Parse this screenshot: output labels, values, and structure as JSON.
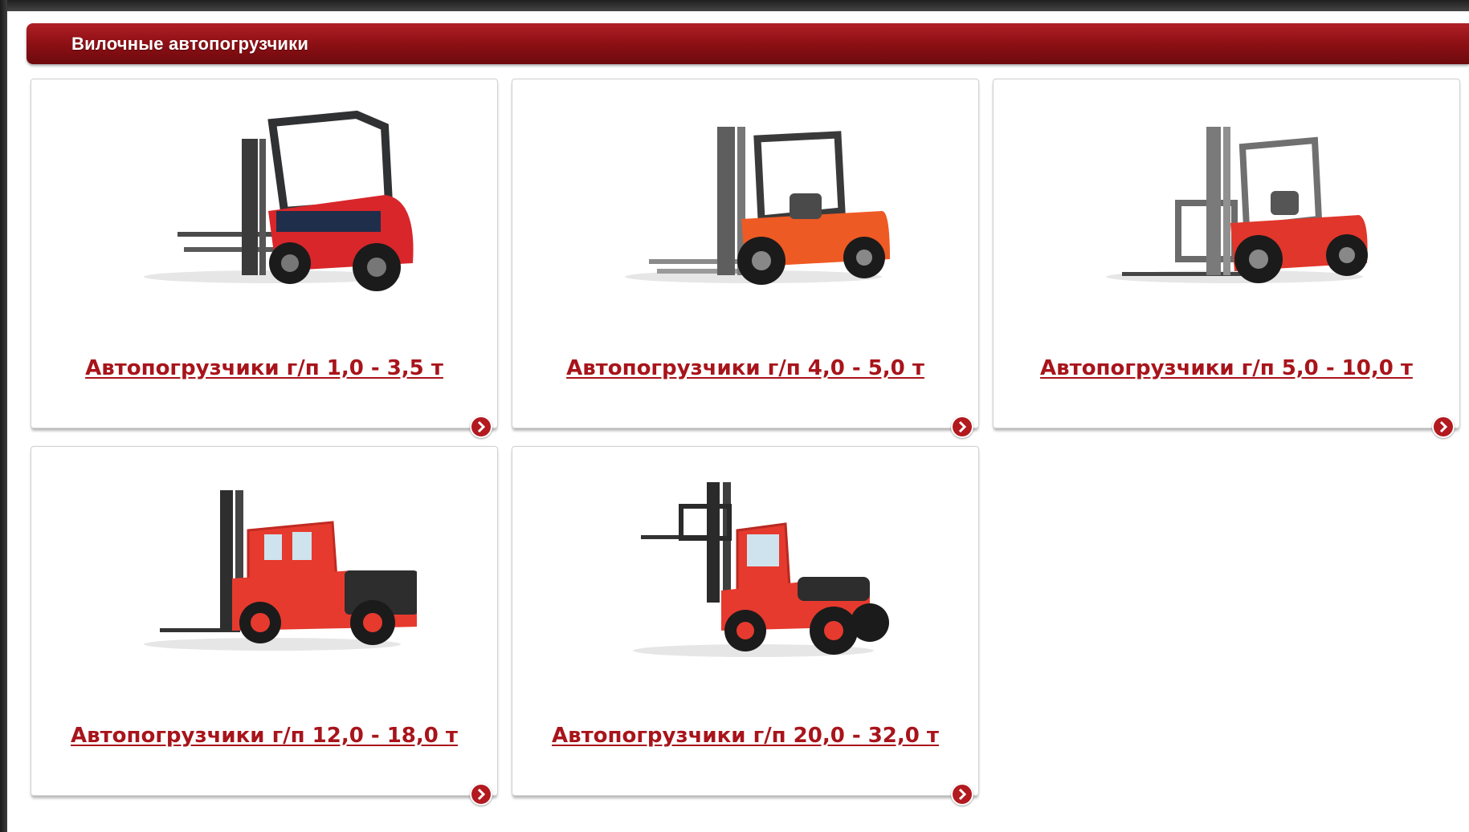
{
  "section": {
    "title": "Вилочные автопогрузчики"
  },
  "products": [
    {
      "label": "Автопогрузчики г/п 1,0 - 3,5 т",
      "image": "forklift-red-small"
    },
    {
      "label": "Автопогрузчики г/п 4,0 - 5,0 т",
      "image": "forklift-orange-medium"
    },
    {
      "label": "Автопогрузчики г/п 5,0 - 10,0 т",
      "image": "forklift-red-large"
    },
    {
      "label": "Автопогрузчики г/п 12,0 - 18,0 т",
      "image": "forklift-heavy-red"
    },
    {
      "label": "Автопогрузчики г/п 20,0 - 32,0 т",
      "image": "forklift-heavy-container"
    }
  ],
  "icons": {
    "card_arrow": "chevron-right-circle-icon"
  },
  "colors": {
    "accent": "#a8141b",
    "header_bar": "#8e1015"
  }
}
